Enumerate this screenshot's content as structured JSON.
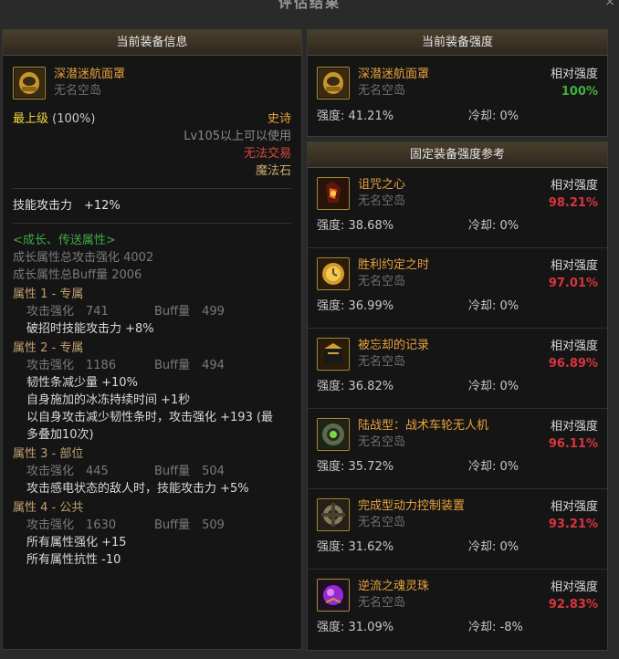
{
  "window": {
    "title": "评估结果",
    "close": "×"
  },
  "left": {
    "header": "当前装备信息",
    "item": {
      "name": "深潜迷航面罩",
      "sub": "无名空岛"
    },
    "grade": "最上级",
    "grade_pct": "(100%)",
    "rarity": "史诗",
    "requirement": "Lv105以上可以使用",
    "untradeable": "无法交易",
    "material": "魔法石",
    "skill_attack": "技能攻击力　+12%",
    "growth": {
      "title": "<成长、传送属性>",
      "line1": "成长属性总攻击强化 4002",
      "line2": "成长属性总Buff量 2006"
    },
    "attrs": [
      {
        "title": "属性 1 - 专属",
        "atk": "攻击强化　741",
        "buff": "Buff量　499",
        "lines": [
          "破招时技能攻击力 +8%"
        ]
      },
      {
        "title": "属性 2 - 专属",
        "atk": "攻击强化　1186",
        "buff": "Buff量　494",
        "lines": [
          "韧性条减少量 +10%",
          "自身施加的冰冻持续时间 +1秒",
          "以自身攻击减少韧性条时，攻击强化 +193 (最",
          "多叠加10次)"
        ]
      },
      {
        "title": "属性 3 - 部位",
        "atk": "攻击强化　445",
        "buff": "Buff量　504",
        "lines": [
          "攻击感电状态的敌人时，技能攻击力 +5%"
        ]
      },
      {
        "title": "属性 4 - 公共",
        "atk": "攻击强化　1630",
        "buff": "Buff量　509",
        "lines": [
          "所有属性强化 +15",
          "所有属性抗性 -10"
        ]
      }
    ]
  },
  "current_strength": {
    "header": "当前装备强度",
    "item": {
      "name": "深潜迷航面罩",
      "sub": "无名空岛"
    },
    "rel_label": "相对强度",
    "rel_pct": "100%",
    "strength": "强度: 41.21%",
    "cooldown": "冷却: 0%"
  },
  "reference": {
    "header": "固定装备强度参考",
    "rel_label": "相对强度",
    "items": [
      {
        "name": "诅咒之心",
        "sub": "无名空岛",
        "rel_pct": "98.21%",
        "strength": "强度: 38.68%",
        "cooldown": "冷却: 0%",
        "icon": "cursed-heart-icon"
      },
      {
        "name": "胜利约定之时",
        "sub": "无名空岛",
        "rel_pct": "97.01%",
        "strength": "强度: 36.99%",
        "cooldown": "冷却: 0%",
        "icon": "golden-watch-icon"
      },
      {
        "name": "被忘却的记录",
        "sub": "无名空岛",
        "rel_pct": "96.89%",
        "strength": "强度: 36.82%",
        "cooldown": "冷却: 0%",
        "icon": "black-box-icon"
      },
      {
        "name": "陆战型：战术车轮无人机",
        "sub": "无名空岛",
        "rel_pct": "96.11%",
        "strength": "强度: 35.72%",
        "cooldown": "冷却: 0%",
        "icon": "drone-wheel-icon"
      },
      {
        "name": "完成型动力控制装置",
        "sub": "无名空岛",
        "rel_pct": "93.21%",
        "strength": "强度: 31.62%",
        "cooldown": "冷却: 0%",
        "icon": "power-device-icon"
      },
      {
        "name": "逆流之魂灵珠",
        "sub": "无名空岛",
        "rel_pct": "92.83%",
        "strength": "强度: 31.09%",
        "cooldown": "冷却: -8%",
        "icon": "soul-orb-icon"
      }
    ]
  }
}
